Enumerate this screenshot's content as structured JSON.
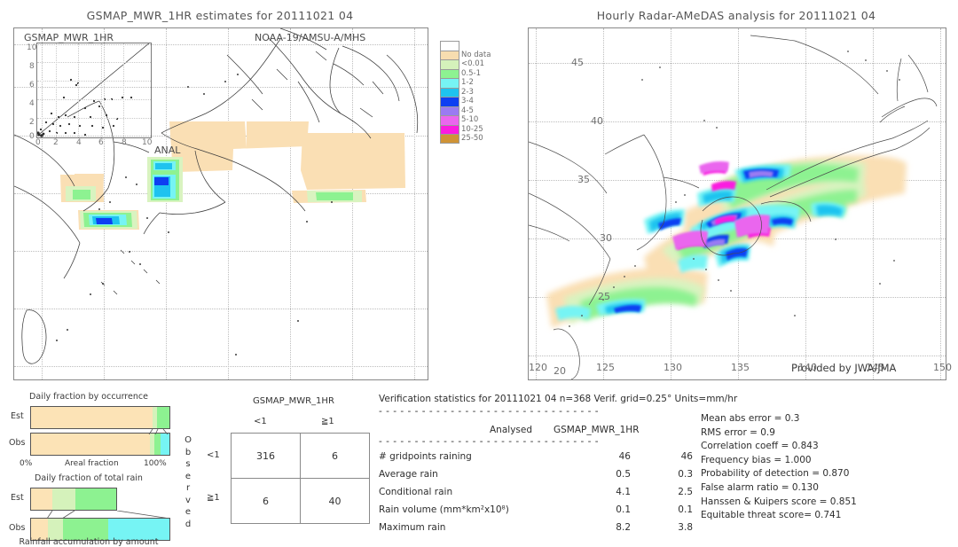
{
  "left_panel": {
    "title": "GSMAP_MWR_1HR estimates for 20111021 04",
    "corner_label": "GSMAP_MWR_1HR",
    "sensor_label": "NOAA-19/AMSU-A/MHS",
    "inset": {
      "xlabel": "ANAL",
      "yticks": [
        "10",
        "8",
        "6",
        "4",
        "2",
        "0"
      ],
      "xticks": [
        "0",
        "2",
        "4",
        "6",
        "8",
        "10"
      ]
    }
  },
  "right_panel": {
    "title": "Hourly Radar-AMeDAS analysis for 20111021 04",
    "credit": "Provided by JWA/JMA",
    "lon_ticks": [
      "120",
      "125",
      "130",
      "135",
      "140",
      "145",
      "150"
    ],
    "lat_ticks": [
      "45",
      "40",
      "35",
      "30",
      "25",
      "20"
    ]
  },
  "colorbar": {
    "labels": [
      "No data",
      "<0.01",
      "0.5-1",
      "1-2",
      "2-3",
      "3-4",
      "4-5",
      "5-10",
      "10-25",
      "25-50"
    ],
    "colors": [
      "#ffffff",
      "#f7ddb0",
      "#d5f2bb",
      "#8df291",
      "#76f4f4",
      "#1ec3ef",
      "#0e3ff2",
      "#9a7bf2",
      "#ea66ee",
      "#fb1ae0",
      "#cf9336"
    ]
  },
  "bars": {
    "occurrence_title": "Daily fraction by occurrence",
    "total_rain_title": "Daily fraction of total rain",
    "bottom_caption": "Rainfall accumulation by amount",
    "axis_left": "0%",
    "axis_mid": "Areal fraction",
    "axis_right": "100%",
    "row_est": "Est",
    "row_obs": "Obs",
    "occurrence": {
      "est": [
        {
          "color": "#fce3b6",
          "pct": 87.5
        },
        {
          "color": "#d5f2bb",
          "pct": 3.5
        },
        {
          "color": "#8df291",
          "pct": 9.0
        }
      ],
      "obs": [
        {
          "color": "#fce3b6",
          "pct": 86.0
        },
        {
          "color": "#d5f2bb",
          "pct": 3.0
        },
        {
          "color": "#8df291",
          "pct": 4.5
        },
        {
          "color": "#76f4f4",
          "pct": 6.5
        }
      ]
    },
    "total_rain": {
      "est": [
        {
          "color": "#fce3b6",
          "pct": 16.0
        },
        {
          "color": "#d5f2bb",
          "pct": 16.0
        },
        {
          "color": "#8df291",
          "pct": 30.0
        }
      ],
      "obs": [
        {
          "color": "#fce3b6",
          "pct": 12.0
        },
        {
          "color": "#d5f2bb",
          "pct": 11.0
        },
        {
          "color": "#8df291",
          "pct": 33.0
        },
        {
          "color": "#76f4f4",
          "pct": 44.0
        }
      ]
    }
  },
  "contingency": {
    "title": "GSMAP_MWR_1HR",
    "observed_label": "Observed",
    "col_headers": [
      "<1",
      "≧1"
    ],
    "row_headers": [
      "<1",
      "≧1"
    ],
    "cells": [
      [
        "316",
        "6"
      ],
      [
        "6",
        "40"
      ]
    ]
  },
  "chart_data": {
    "type": "table",
    "title": "Verification statistics for 20111021 04   n=368  Verif. grid=0.25°  Units=mm/hr",
    "header_row": [
      "",
      "Analysed",
      "GSMAP_MWR_1HR"
    ],
    "rows": [
      {
        "label": "# gridpoints raining",
        "analysed": "46",
        "estimate": "46"
      },
      {
        "label": "Average rain",
        "analysed": "0.5",
        "estimate": "0.3"
      },
      {
        "label": "Conditional rain",
        "analysed": "4.1",
        "estimate": "2.5"
      },
      {
        "label": "Rain volume (mm*km²x10⁸)",
        "analysed": "0.1",
        "estimate": "0.1"
      },
      {
        "label": "Maximum rain",
        "analysed": "8.2",
        "estimate": "3.8"
      }
    ],
    "scores": [
      "Mean abs error = 0.3",
      "RMS error = 0.9",
      "Correlation coeff = 0.843",
      "Frequency bias = 1.000",
      "Probability of detection = 0.870",
      "False alarm ratio = 0.130",
      "Hanssen & Kuipers score = 0.851",
      "Equitable threat score= 0.741"
    ],
    "divider": "- - - - - - - - - - - - - - - - - - - - - - - - - - - - - - -"
  }
}
